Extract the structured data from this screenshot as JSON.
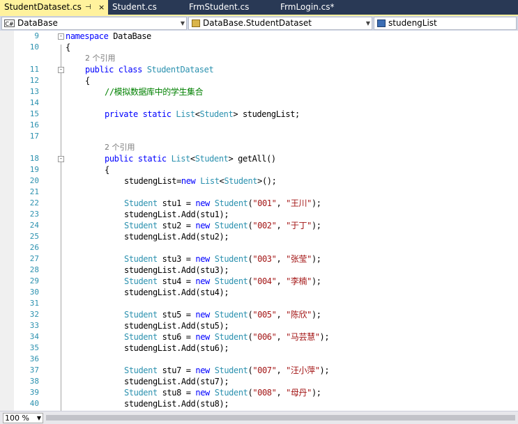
{
  "tabs": [
    {
      "label": "StudentDataset.cs",
      "active": true,
      "pinned": true
    },
    {
      "label": "Student.cs",
      "active": false
    },
    {
      "label": "FrmStudent.cs",
      "active": false
    },
    {
      "label": "FrmLogin.cs*",
      "active": false
    }
  ],
  "tab_pin_icon": "⊣",
  "tab_close_icon": "×",
  "navbar": {
    "project_icon_text": "C#",
    "project": "DataBase",
    "class": "DataBase.StudentDataset",
    "member": "studengList"
  },
  "dropdown_arrow": "▼",
  "colors": {
    "tab_active": "#fff29d",
    "tabstrip": "#293955",
    "keyword": "#0000ff",
    "type": "#2b91af",
    "string": "#a31515",
    "comment": "#008000",
    "codelens": "#7a7a7a",
    "line_number": "#2b91af"
  },
  "code_lines": [
    {
      "n": "9",
      "fold": "-",
      "indent": 0,
      "tokens": [
        {
          "t": "namespace",
          "c": "kw"
        },
        {
          "t": " DataBase"
        }
      ]
    },
    {
      "n": "10",
      "indent": 0,
      "tokens": [
        {
          "t": "{"
        }
      ]
    },
    {
      "n": "",
      "lens": true,
      "indent": 1,
      "tokens": [
        {
          "t": "2 个引用"
        }
      ]
    },
    {
      "n": "11",
      "fold": "-",
      "indent": 1,
      "tokens": [
        {
          "t": "public",
          "c": "kw"
        },
        {
          "t": " "
        },
        {
          "t": "class",
          "c": "kw"
        },
        {
          "t": " "
        },
        {
          "t": "StudentDataset",
          "c": "ty"
        }
      ]
    },
    {
      "n": "12",
      "indent": 1,
      "tokens": [
        {
          "t": "{"
        }
      ]
    },
    {
      "n": "13",
      "indent": 2,
      "tokens": [
        {
          "t": "//模拟数据库中的学生集合",
          "c": "cm"
        }
      ]
    },
    {
      "n": "14",
      "indent": 2,
      "tokens": []
    },
    {
      "n": "15",
      "indent": 2,
      "tokens": [
        {
          "t": "private",
          "c": "kw"
        },
        {
          "t": " "
        },
        {
          "t": "static",
          "c": "kw"
        },
        {
          "t": " "
        },
        {
          "t": "List",
          "c": "ty"
        },
        {
          "t": "<"
        },
        {
          "t": "Student",
          "c": "ty"
        },
        {
          "t": "> studengList;"
        }
      ]
    },
    {
      "n": "16",
      "indent": 2,
      "tokens": []
    },
    {
      "n": "17",
      "indent": 2,
      "tokens": []
    },
    {
      "n": "",
      "lens": true,
      "indent": 2,
      "tokens": [
        {
          "t": "2 个引用"
        }
      ]
    },
    {
      "n": "18",
      "fold": "-",
      "indent": 2,
      "tokens": [
        {
          "t": "public",
          "c": "kw"
        },
        {
          "t": " "
        },
        {
          "t": "static",
          "c": "kw"
        },
        {
          "t": " "
        },
        {
          "t": "List",
          "c": "ty"
        },
        {
          "t": "<"
        },
        {
          "t": "Student",
          "c": "ty"
        },
        {
          "t": "> getAll()"
        }
      ]
    },
    {
      "n": "19",
      "indent": 2,
      "tokens": [
        {
          "t": "{"
        }
      ]
    },
    {
      "n": "20",
      "indent": 3,
      "tokens": [
        {
          "t": "studengList="
        },
        {
          "t": "new",
          "c": "kw"
        },
        {
          "t": " "
        },
        {
          "t": "List",
          "c": "ty"
        },
        {
          "t": "<"
        },
        {
          "t": "Student",
          "c": "ty"
        },
        {
          "t": ">();"
        }
      ]
    },
    {
      "n": "21",
      "indent": 3,
      "tokens": []
    },
    {
      "n": "22",
      "indent": 3,
      "tokens": [
        {
          "t": "Student",
          "c": "ty"
        },
        {
          "t": " stu1 = "
        },
        {
          "t": "new",
          "c": "kw"
        },
        {
          "t": " "
        },
        {
          "t": "Student",
          "c": "ty"
        },
        {
          "t": "("
        },
        {
          "t": "\"001\"",
          "c": "st"
        },
        {
          "t": ", "
        },
        {
          "t": "\"王川\"",
          "c": "st"
        },
        {
          "t": ");"
        }
      ]
    },
    {
      "n": "23",
      "indent": 3,
      "tokens": [
        {
          "t": "studengList.Add(stu1);"
        }
      ]
    },
    {
      "n": "24",
      "indent": 3,
      "tokens": [
        {
          "t": "Student",
          "c": "ty"
        },
        {
          "t": " stu2 = "
        },
        {
          "t": "new",
          "c": "kw"
        },
        {
          "t": " "
        },
        {
          "t": "Student",
          "c": "ty"
        },
        {
          "t": "("
        },
        {
          "t": "\"002\"",
          "c": "st"
        },
        {
          "t": ", "
        },
        {
          "t": "\"于丁\"",
          "c": "st"
        },
        {
          "t": ");"
        }
      ]
    },
    {
      "n": "25",
      "indent": 3,
      "tokens": [
        {
          "t": "studengList.Add(stu2);"
        }
      ]
    },
    {
      "n": "26",
      "indent": 3,
      "tokens": []
    },
    {
      "n": "27",
      "indent": 3,
      "tokens": [
        {
          "t": "Student",
          "c": "ty"
        },
        {
          "t": " stu3 = "
        },
        {
          "t": "new",
          "c": "kw"
        },
        {
          "t": " "
        },
        {
          "t": "Student",
          "c": "ty"
        },
        {
          "t": "("
        },
        {
          "t": "\"003\"",
          "c": "st"
        },
        {
          "t": ", "
        },
        {
          "t": "\"张莹\"",
          "c": "st"
        },
        {
          "t": ");"
        }
      ]
    },
    {
      "n": "28",
      "indent": 3,
      "tokens": [
        {
          "t": "studengList.Add(stu3);"
        }
      ]
    },
    {
      "n": "29",
      "indent": 3,
      "tokens": [
        {
          "t": "Student",
          "c": "ty"
        },
        {
          "t": " stu4 = "
        },
        {
          "t": "new",
          "c": "kw"
        },
        {
          "t": " "
        },
        {
          "t": "Student",
          "c": "ty"
        },
        {
          "t": "("
        },
        {
          "t": "\"004\"",
          "c": "st"
        },
        {
          "t": ", "
        },
        {
          "t": "\"李楠\"",
          "c": "st"
        },
        {
          "t": ");"
        }
      ]
    },
    {
      "n": "30",
      "indent": 3,
      "tokens": [
        {
          "t": "studengList.Add(stu4);"
        }
      ]
    },
    {
      "n": "31",
      "indent": 3,
      "tokens": []
    },
    {
      "n": "32",
      "indent": 3,
      "tokens": [
        {
          "t": "Student",
          "c": "ty"
        },
        {
          "t": " stu5 = "
        },
        {
          "t": "new",
          "c": "kw"
        },
        {
          "t": " "
        },
        {
          "t": "Student",
          "c": "ty"
        },
        {
          "t": "("
        },
        {
          "t": "\"005\"",
          "c": "st"
        },
        {
          "t": ", "
        },
        {
          "t": "\"陈欣\"",
          "c": "st"
        },
        {
          "t": ");"
        }
      ]
    },
    {
      "n": "33",
      "indent": 3,
      "tokens": [
        {
          "t": "studengList.Add(stu5);"
        }
      ]
    },
    {
      "n": "34",
      "indent": 3,
      "tokens": [
        {
          "t": "Student",
          "c": "ty"
        },
        {
          "t": " stu6 = "
        },
        {
          "t": "new",
          "c": "kw"
        },
        {
          "t": " "
        },
        {
          "t": "Student",
          "c": "ty"
        },
        {
          "t": "("
        },
        {
          "t": "\"006\"",
          "c": "st"
        },
        {
          "t": ", "
        },
        {
          "t": "\"马芸慧\"",
          "c": "st"
        },
        {
          "t": ");"
        }
      ]
    },
    {
      "n": "35",
      "indent": 3,
      "tokens": [
        {
          "t": "studengList.Add(stu6);"
        }
      ]
    },
    {
      "n": "36",
      "indent": 3,
      "tokens": []
    },
    {
      "n": "37",
      "indent": 3,
      "tokens": [
        {
          "t": "Student",
          "c": "ty"
        },
        {
          "t": " stu7 = "
        },
        {
          "t": "new",
          "c": "kw"
        },
        {
          "t": " "
        },
        {
          "t": "Student",
          "c": "ty"
        },
        {
          "t": "("
        },
        {
          "t": "\"007\"",
          "c": "st"
        },
        {
          "t": ", "
        },
        {
          "t": "\"汪小萍\"",
          "c": "st"
        },
        {
          "t": ");"
        }
      ]
    },
    {
      "n": "38",
      "indent": 3,
      "tokens": [
        {
          "t": "studengList.Add(stu7);"
        }
      ]
    },
    {
      "n": "39",
      "indent": 3,
      "tokens": [
        {
          "t": "Student",
          "c": "ty"
        },
        {
          "t": " stu8 = "
        },
        {
          "t": "new",
          "c": "kw"
        },
        {
          "t": " "
        },
        {
          "t": "Student",
          "c": "ty"
        },
        {
          "t": "("
        },
        {
          "t": "\"008\"",
          "c": "st"
        },
        {
          "t": ", "
        },
        {
          "t": "\"母丹\"",
          "c": "st"
        },
        {
          "t": ");"
        }
      ]
    },
    {
      "n": "40",
      "indent": 3,
      "tokens": [
        {
          "t": "studengList.Add(stu8);"
        }
      ]
    }
  ],
  "zoom": "100 %"
}
